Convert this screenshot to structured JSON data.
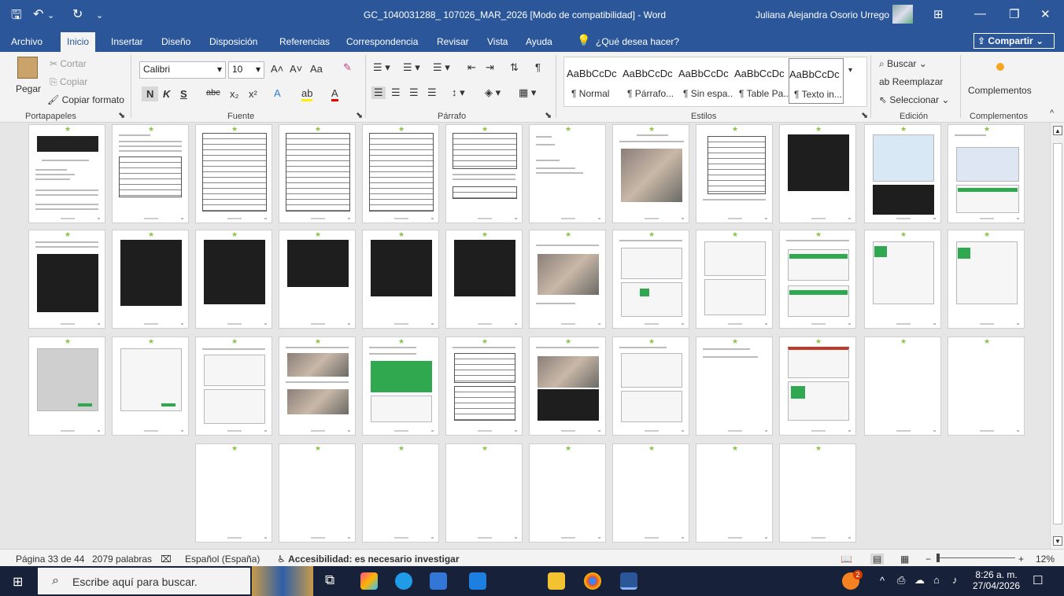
{
  "titlebar": {
    "doc_title": "GC_1040031288_ 107026_MAR_2026 [Modo de compatibilidad]  -  Word",
    "user": "Juliana Alejandra Osorio Urrego",
    "save_glyph": "🖫",
    "undo_glyph": "↶",
    "redo_glyph": "↻",
    "qat_more_glyph": "⌄",
    "layout_glyph": "⊞",
    "minimize_glyph": "—",
    "restore_glyph": "❐",
    "close_glyph": "✕"
  },
  "tabs": {
    "items": [
      "Archivo",
      "Inicio",
      "Insertar",
      "Diseño",
      "Disposición",
      "Referencias",
      "Correspondencia",
      "Revisar",
      "Vista",
      "Ayuda"
    ],
    "active": "Inicio",
    "tell_me": "¿Qué desea hacer?",
    "share": "Compartir"
  },
  "ribbon": {
    "clipboard": {
      "paste": "Pegar",
      "cut": "Cortar",
      "copy": "Copiar",
      "format_painter": "Copiar formato",
      "group": "Portapapeles"
    },
    "font": {
      "name": "Calibri",
      "size": "10",
      "grow": "A˄",
      "shrink": "A˅",
      "case": "Aa",
      "bold": "N",
      "italic": "K",
      "underline": "S",
      "strike": "abc",
      "subscript": "x₂",
      "superscript": "x²",
      "effects": "A",
      "highlight": "ab",
      "color": "A",
      "group": "Fuente"
    },
    "paragraph": {
      "group": "Párrafo",
      "pilcrow": "¶"
    },
    "styles": {
      "group": "Estilos",
      "preview": "AaBbCcDc",
      "items": [
        "¶ Normal",
        "¶ Párrafo...",
        "¶ Sin espa...",
        "¶ Table Pa...",
        "¶ Texto in..."
      ],
      "selected_index": 4
    },
    "editing": {
      "group": "Edición",
      "find": "Buscar",
      "replace": "Reemplazar",
      "select": "Seleccionar"
    },
    "addins": {
      "label": "Complementos",
      "group": "Complementos"
    }
  },
  "status": {
    "page": "Página 33 de 44",
    "words": "2079 palabras",
    "language": "Español (España)",
    "accessibility": "Accesibilidad: es necesario investigar",
    "zoom": "12%",
    "zoom_level_percent": 12
  },
  "taskbar": {
    "search_placeholder": "Escribe aquí para buscar.",
    "time": "8:26 a. m.",
    "date": "27/04/2026",
    "notification_badge": "2"
  },
  "colors": {
    "word_blue": "#2b579a",
    "ribbon_bg": "#f3f3f3",
    "doc_bg": "#e6e6e6",
    "taskbar": "#17223a"
  }
}
